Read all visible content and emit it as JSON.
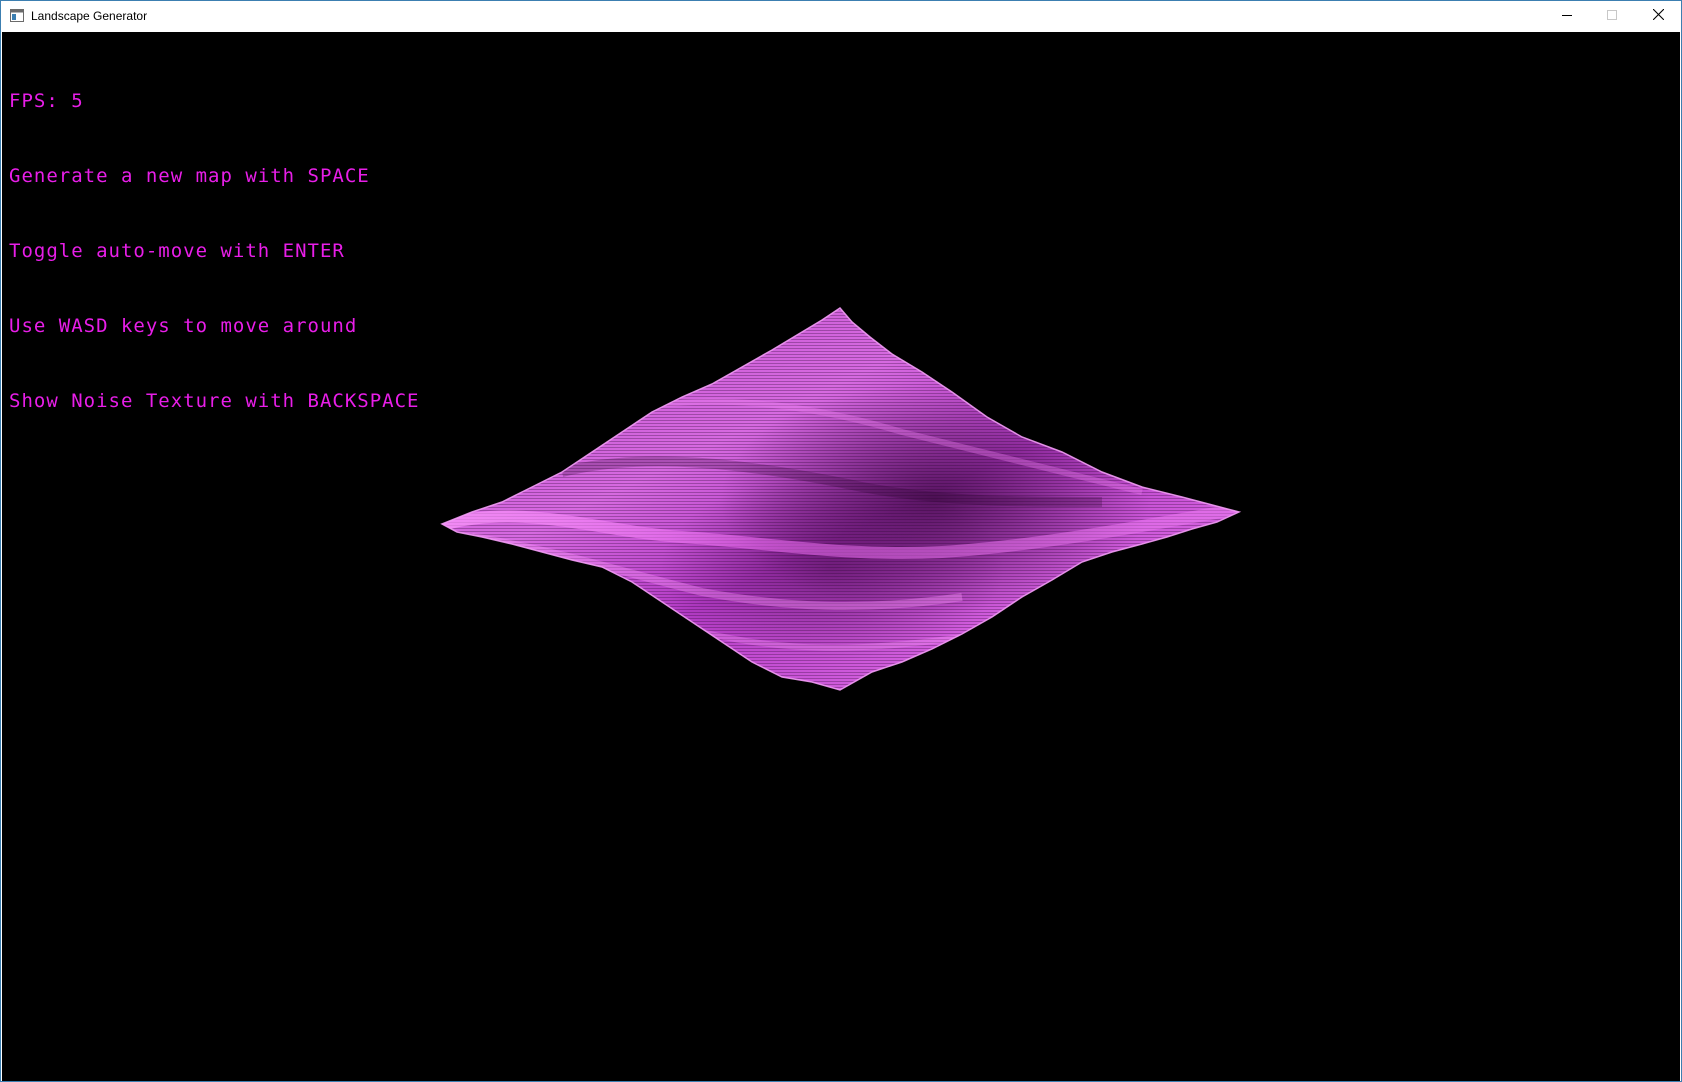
{
  "window": {
    "title": "Landscape Generator",
    "controls": {
      "minimize_icon": "minimize-icon",
      "maximize_icon": "maximize-icon",
      "close_icon": "close-icon"
    }
  },
  "hud": {
    "color": "#e81ee8",
    "fps_label": "FPS: 5",
    "lines": [
      "Generate a new map with SPACE",
      "Toggle auto-move with ENTER",
      "Use WASD keys to move around",
      "Show Noise Texture with BACKSPACE"
    ]
  },
  "scene": {
    "background": "#000000",
    "terrain_color": "#e060e8",
    "terrain_dark": "#5a0e62",
    "terrain_light": "#ffb0ff"
  }
}
